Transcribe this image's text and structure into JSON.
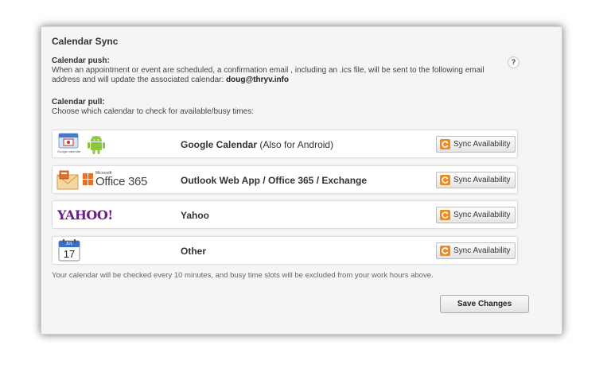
{
  "section": {
    "title": "Calendar Sync",
    "help_label": "?"
  },
  "push": {
    "heading": "Calendar push:",
    "text": "When an appointment or event are scheduled, a confirmation email , including an .ics file, will be sent to the following email address and will update the associated calendar:",
    "email": "doug@thryv.info"
  },
  "pull": {
    "heading": "Calendar pull:",
    "text": "Choose which calendar to check for available/busy times:"
  },
  "calendars": [
    {
      "name": "Google Calendar",
      "note": "(Also for Android)",
      "sync_label": "Sync Availability",
      "logo_text": "Google calendar"
    },
    {
      "name": "Outlook Web App / Office 365 / Exchange",
      "note": "",
      "sync_label": "Sync Availability",
      "logo_text": "Office 365",
      "logo_small": "Microsoft"
    },
    {
      "name": "Yahoo",
      "note": "",
      "sync_label": "Sync Availability",
      "logo_text": "YAHOO!"
    },
    {
      "name": "Other",
      "note": "",
      "sync_label": "Sync Availability",
      "logo_text": "17",
      "logo_small": "JUL"
    }
  ],
  "footer_note": "Your calendar will be checked every 10 minutes, and busy time slots will be excluded from your work hours above.",
  "save_label": "Save Changes",
  "colors": {
    "panel_bg": "#f5f5f5",
    "sync_icon": "#f08a1c",
    "yahoo": "#6b1e88",
    "android": "#8cc63f",
    "office": "#e8712a"
  }
}
